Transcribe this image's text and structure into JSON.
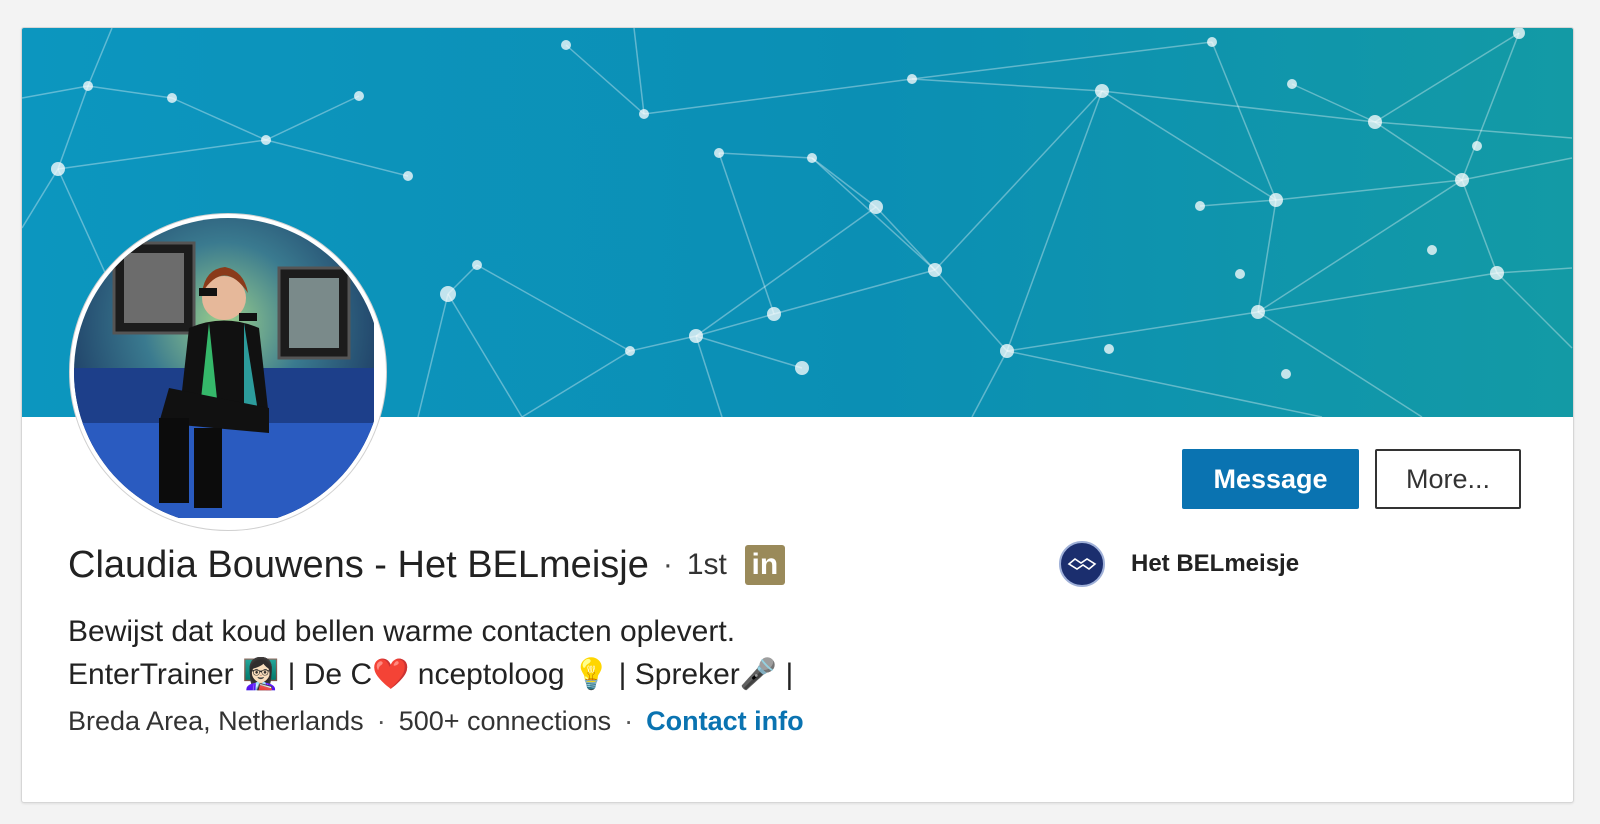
{
  "profile": {
    "name": "Claudia Bouwens - Het BELmeisje",
    "separator": "·",
    "degree": "1st",
    "premium_badge": "in",
    "headline_line1": "Bewijst dat koud bellen warme contacten oplevert.",
    "headline_line2": "EnterTrainer 👩🏻‍🏫 | De C❤️ nceptoloog 💡 | Spreker🎤 |",
    "location": "Breda Area, Netherlands",
    "connections": "500+ connections",
    "contact_info": "Contact info"
  },
  "actions": {
    "message_label": "Message",
    "more_label": "More..."
  },
  "company": {
    "name": "Het BELmeisje"
  },
  "colors": {
    "accent": "#0a73b1",
    "banner": "#0c96bf",
    "premium_gold": "#9a8a5a"
  }
}
